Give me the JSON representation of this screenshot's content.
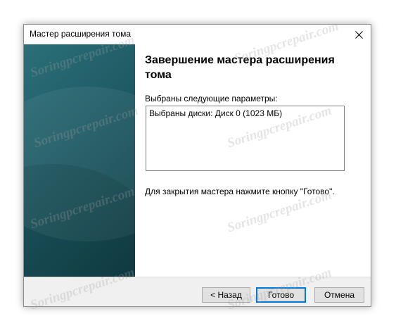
{
  "window": {
    "title": "Мастер расширения тома",
    "close_icon": "close-icon"
  },
  "content": {
    "heading": "Завершение мастера расширения тома",
    "params_label": "Выбраны следующие параметры:",
    "params_text": "Выбраны диски: Диск 0 (1023 МБ)",
    "close_hint": "Для закрытия мастера нажмите кнопку \"Готово\"."
  },
  "buttons": {
    "back": "< Назад",
    "finish": "Готово",
    "cancel": "Отмена"
  },
  "watermark": {
    "text": "Soringpcrepair.com"
  },
  "colors": {
    "side_panel": "#1f5c66",
    "default_button_border": "#0078d7"
  }
}
